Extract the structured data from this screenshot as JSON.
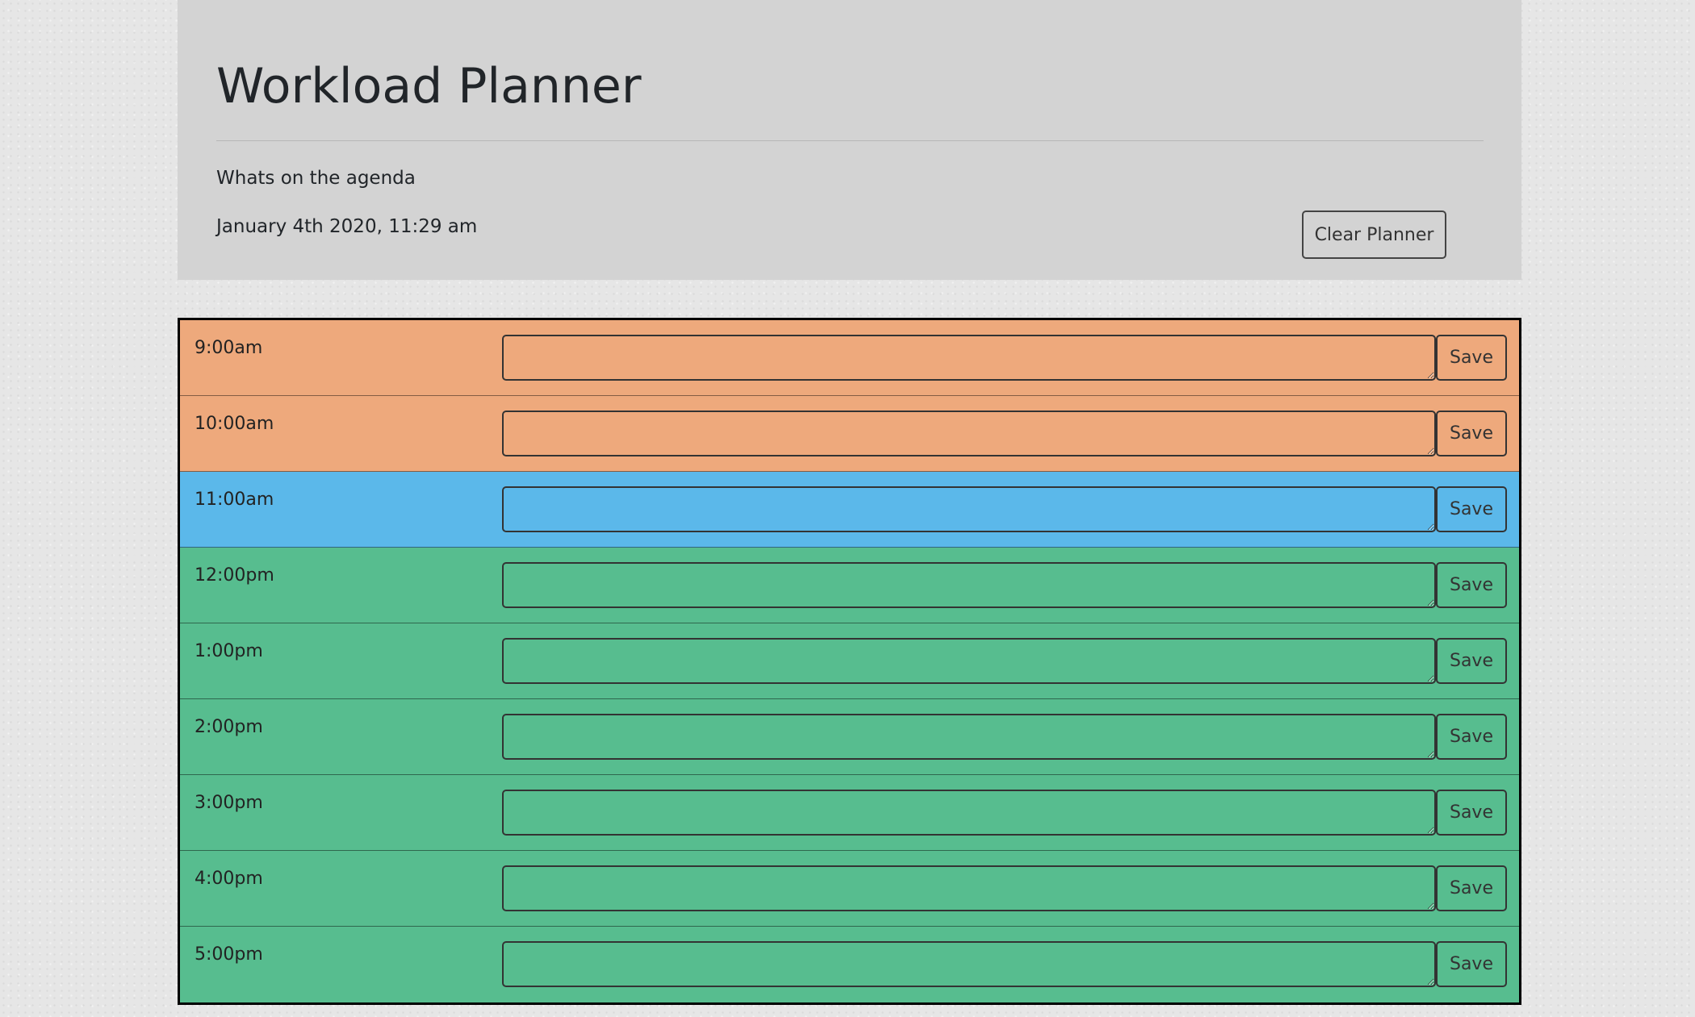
{
  "header": {
    "title": "Workload Planner",
    "subtitle": "Whats on the agenda",
    "current_datetime": "January 4th 2020, 11:29 am",
    "clear_button_label": "Clear Planner"
  },
  "colors": {
    "past": "#eea97c",
    "present": "#5bb8ea",
    "future": "#57bd8f",
    "header_background": "#d3d3d3"
  },
  "planner": {
    "save_label": "Save",
    "hours": [
      {
        "label": "9:00am",
        "status": "past",
        "value": ""
      },
      {
        "label": "10:00am",
        "status": "past",
        "value": ""
      },
      {
        "label": "11:00am",
        "status": "present",
        "value": ""
      },
      {
        "label": "12:00pm",
        "status": "future",
        "value": ""
      },
      {
        "label": "1:00pm",
        "status": "future",
        "value": ""
      },
      {
        "label": "2:00pm",
        "status": "future",
        "value": ""
      },
      {
        "label": "3:00pm",
        "status": "future",
        "value": ""
      },
      {
        "label": "4:00pm",
        "status": "future",
        "value": ""
      },
      {
        "label": "5:00pm",
        "status": "future",
        "value": ""
      }
    ]
  }
}
